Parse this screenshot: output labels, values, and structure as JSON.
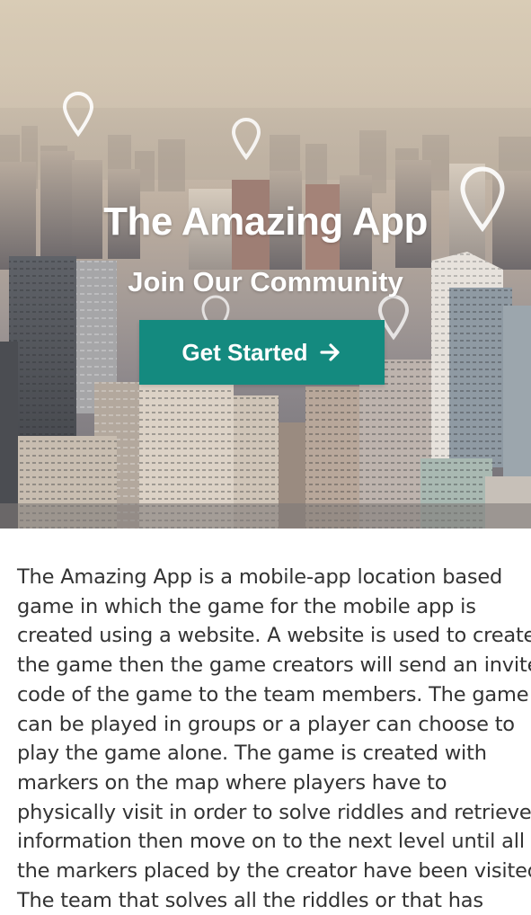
{
  "hero": {
    "title": "The Amazing App",
    "subtitle": "Join Our Community",
    "cta_label": "Get Started",
    "cta_icon": "arrow-right-icon",
    "background_description_icon": "location-pin-icon"
  },
  "colors": {
    "accent": "#148a7f",
    "text": "#333333",
    "hero_text": "#ffffff"
  },
  "content": {
    "lines": [
      "The Amazing App is a mobile-app location based",
      "game in which the game for the mobile app is",
      "created using a website. A website is used to create",
      "the game then the game creators will send an invite",
      "code of the game to the team members. The game",
      "can be played in groups or a player can choose to",
      "play the game alone. The game is created with",
      "markers on the map where players have to",
      "physically visit in order to solve riddles and retrieve",
      "information then move on to the next level until all",
      "the markers placed by the creator have been visited.",
      "The team that solves all the riddles or that has"
    ]
  }
}
